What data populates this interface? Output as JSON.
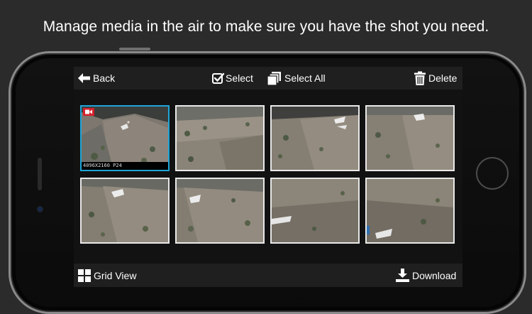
{
  "headline": "Manage media in the air to make sure you have the shot you need.",
  "toolbar": {
    "back_label": "Back",
    "select_label": "Select",
    "select_all_label": "Select All",
    "delete_label": "Delete",
    "icons": [
      "back-arrow-icon",
      "checkbox-icon",
      "stacked-pages-icon",
      "trash-icon"
    ]
  },
  "media": {
    "selected_index": 0,
    "items": [
      {
        "type": "video",
        "resolution_label": "4096X2160 P24",
        "selected": true
      },
      {
        "type": "photo",
        "selected": false
      },
      {
        "type": "photo",
        "selected": false
      },
      {
        "type": "photo",
        "selected": false
      },
      {
        "type": "photo",
        "selected": false
      },
      {
        "type": "photo",
        "selected": false
      },
      {
        "type": "photo",
        "selected": false
      },
      {
        "type": "photo",
        "selected": false
      }
    ]
  },
  "bottombar": {
    "grid_view_label": "Grid View",
    "download_label": "Download",
    "icons": [
      "grid-icon",
      "download-icon"
    ]
  },
  "colors": {
    "background": "#2b2b2b",
    "selection": "#1ea5d8",
    "video_badge": "#d6202b",
    "toolbar": "#1f1f1f"
  }
}
